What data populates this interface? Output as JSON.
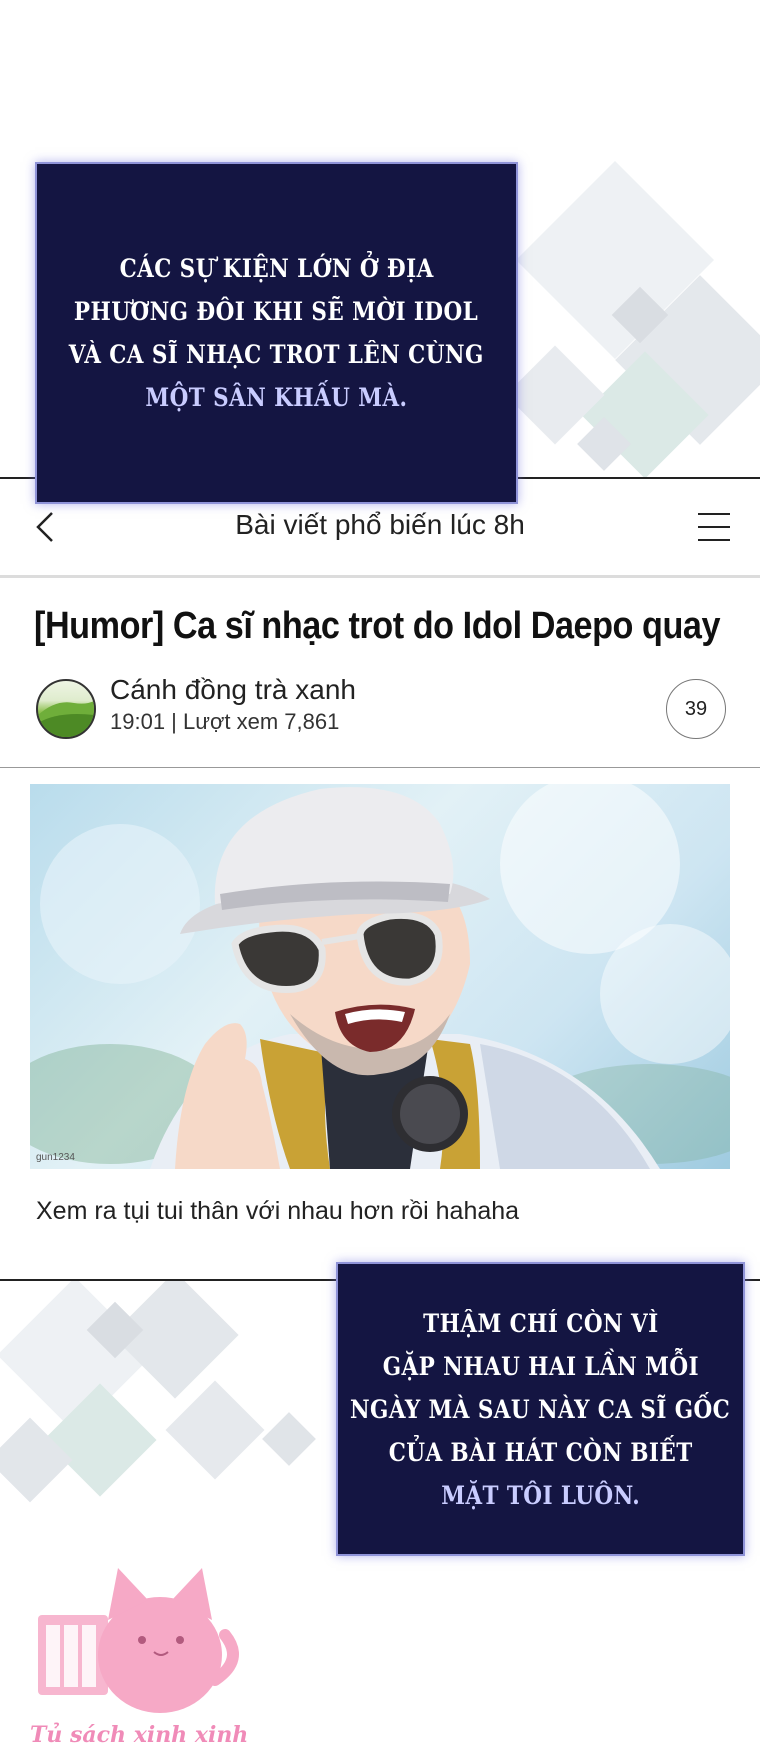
{
  "narration_top": {
    "lines": [
      "CÁC SỰ KIỆN LỚN Ở ĐỊA",
      "PHƯƠNG ĐÔI KHI SẼ MỜI IDOL",
      "VÀ CA SĨ NHẠC TROT LÊN CÙNG",
      "MỘT SÂN KHẤU MÀ."
    ]
  },
  "app": {
    "header_title": "Bài viết phổ biến lúc 8h",
    "post": {
      "title": "[Humor] Ca sĩ nhạc trot do Idol Daepo quay",
      "author": "Cánh đồng trà xanh",
      "meta": "19:01  |  Lượt xem 7,861",
      "comment_count": "39",
      "image_credit": "gun1234",
      "caption": "Xem ra tụi tui thân với nhau hơn rồi hahaha"
    }
  },
  "narration_bottom": {
    "lines": [
      "THẬM CHÍ CÒN VÌ",
      "GẶP NHAU HAI LẦN MỖI",
      "NGÀY MÀ SAU NÀY CA SĨ GỐC",
      "CỦA BÀI HÁT CÒN BIẾT",
      "MẶT TÔI LUÔN."
    ]
  },
  "watermark": {
    "text": "Tủ sách xinh xinh"
  },
  "colors": {
    "narration_bg": "#141542",
    "narration_border": "#8f93d8",
    "narration_highlight": "#c9ccff",
    "watermark_pink": "#f08bb8"
  }
}
